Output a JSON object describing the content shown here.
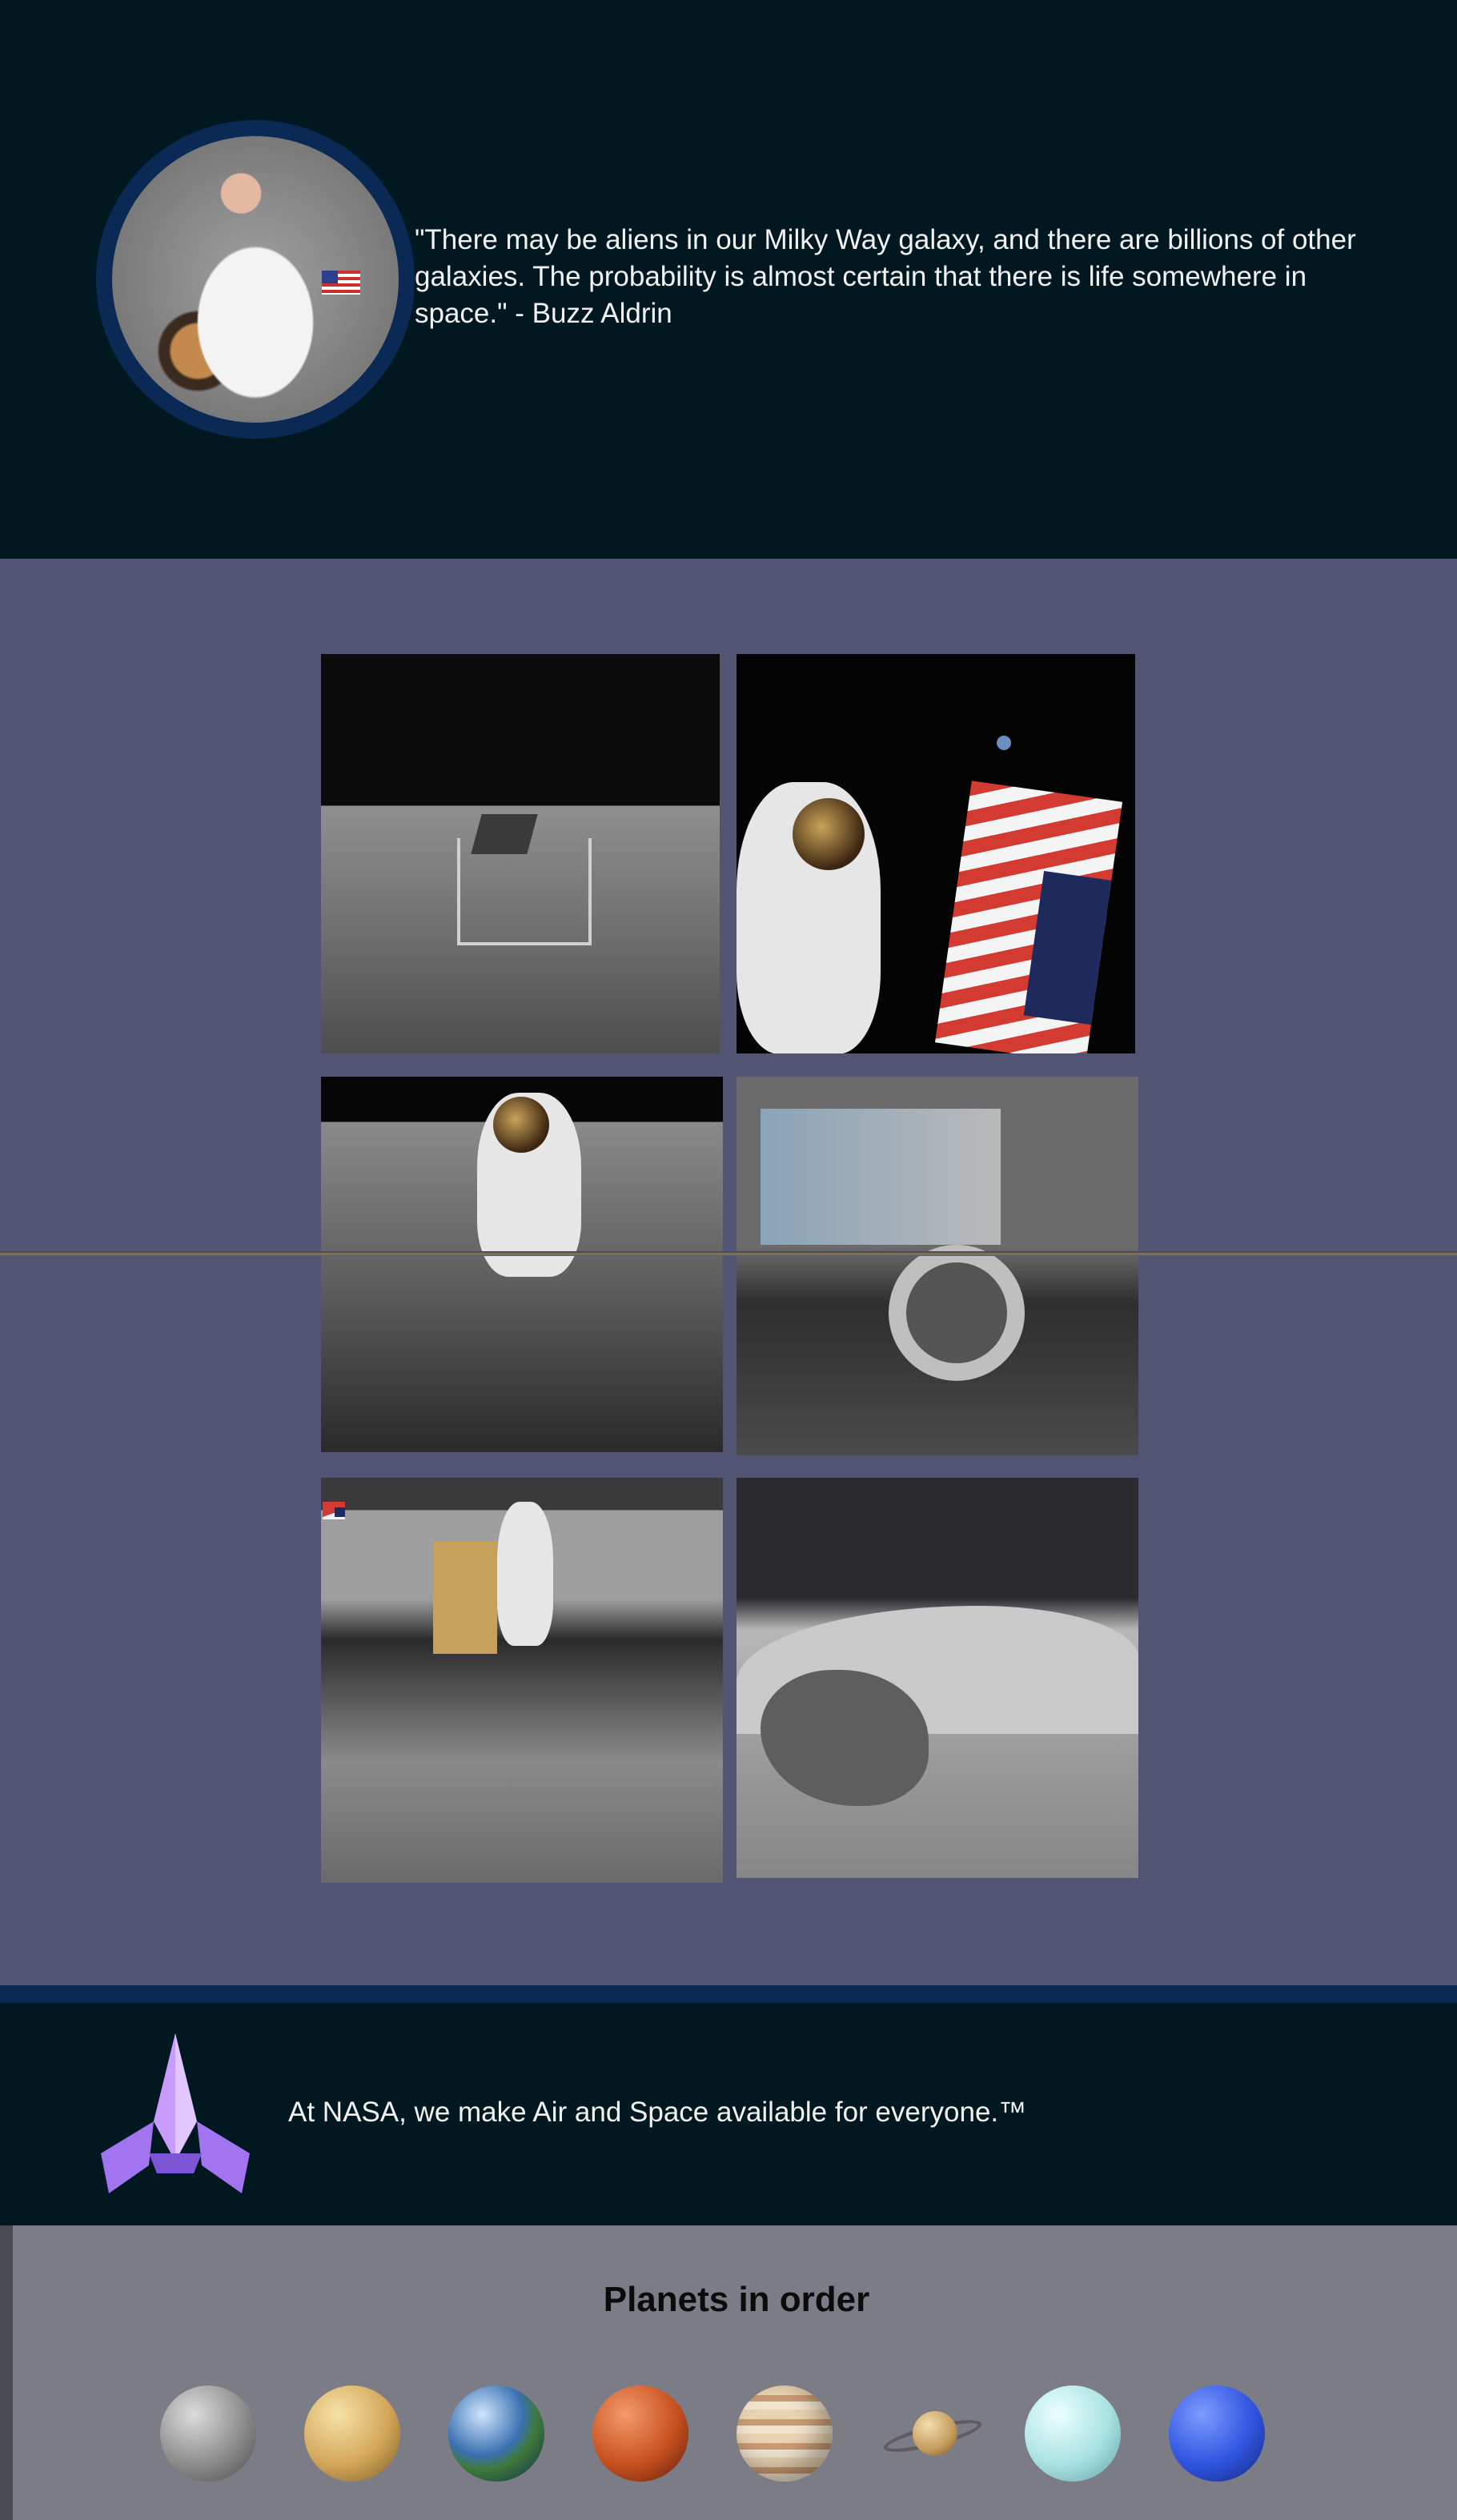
{
  "quote": {
    "text": "\"There may be aliens in our Milky Way galaxy, and there are billions of other galaxies. The probability is almost certain that there is life somewhere in space.\" - Buzz Aldrin"
  },
  "gallery": {
    "photos": [
      {
        "subject": "lunar lander on moon surface"
      },
      {
        "subject": "astronaut with american flag"
      },
      {
        "subject": "astronaut walking on moon"
      },
      {
        "subject": "lunar rover wheel"
      },
      {
        "subject": "astronaut with equipment and flag"
      },
      {
        "subject": "moon boulder and hills"
      }
    ]
  },
  "tagline": {
    "text": "At NASA, we make Air and Space available for everyone.™",
    "logo_icon": "rocket-icon"
  },
  "planets": {
    "title": "Planets in order",
    "items": [
      "mercury",
      "venus",
      "earth",
      "mars",
      "jupiter",
      "saturn",
      "uranus",
      "neptune"
    ]
  },
  "colors": {
    "dark_navy": "#011821",
    "gallery_bg": "#525474",
    "planets_bg": "#7b7c85",
    "accent_band": "#0a2a55"
  }
}
